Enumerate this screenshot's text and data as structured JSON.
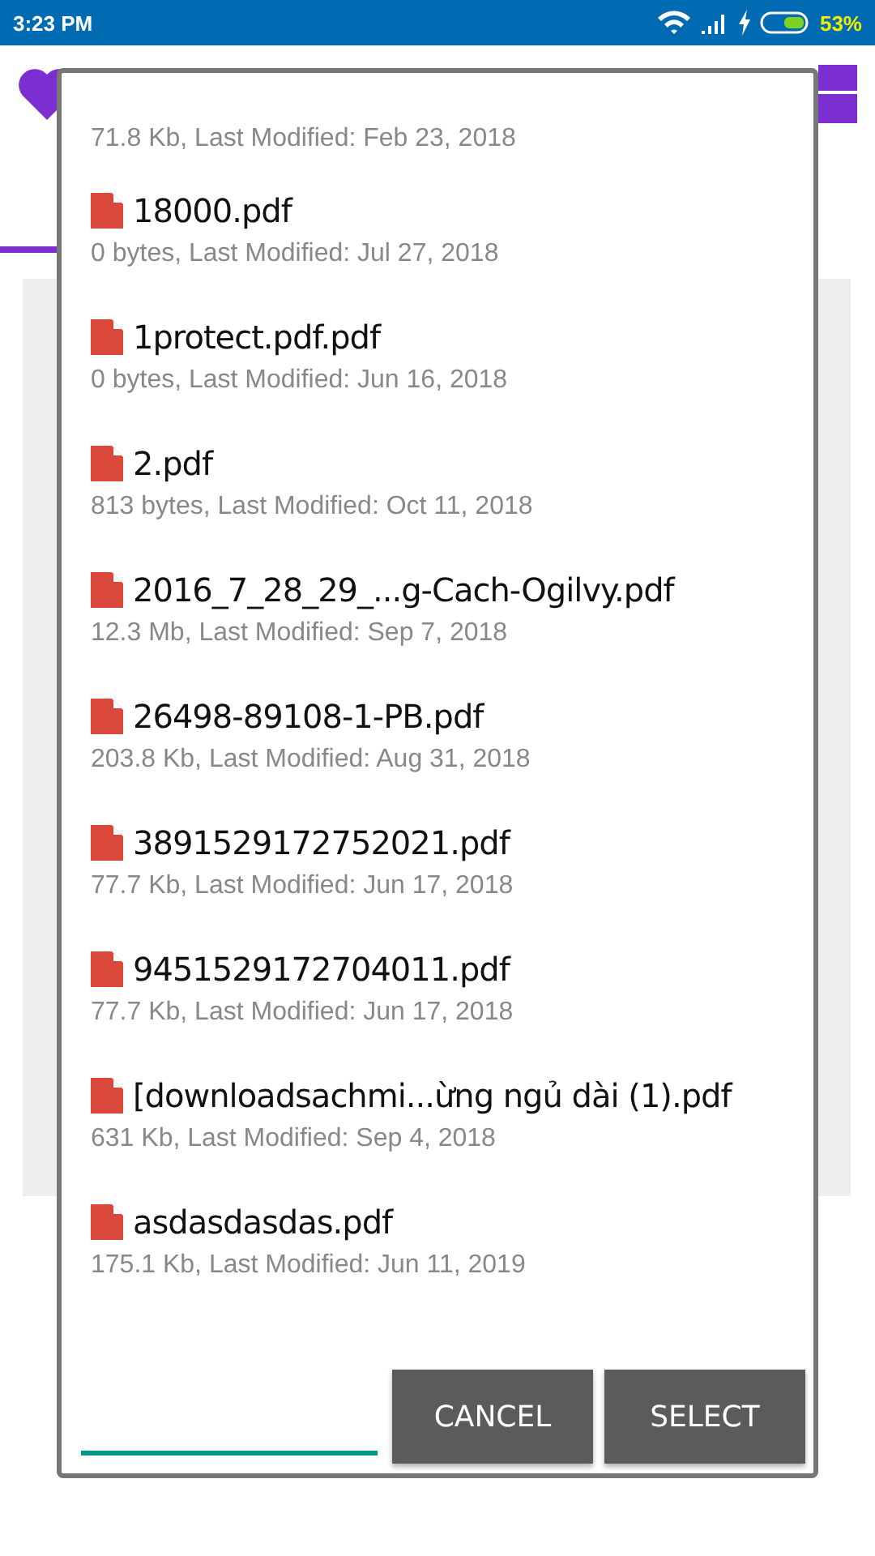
{
  "status_bar": {
    "time": "3:23 PM",
    "battery": "53%"
  },
  "dialog": {
    "files": [
      {
        "meta": "71.8 Kb, Last Modified: Feb 23, 2018"
      },
      {
        "name": "18000.pdf",
        "meta": "0 bytes, Last Modified: Jul 27, 2018"
      },
      {
        "name": "1protect.pdf.pdf",
        "meta": "0 bytes, Last Modified: Jun 16, 2018"
      },
      {
        "name": "2.pdf",
        "meta": "813 bytes, Last Modified: Oct 11, 2018"
      },
      {
        "name": "2016_7_28_29_...g-Cach-Ogilvy.pdf",
        "meta": "12.3 Mb, Last Modified: Sep 7, 2018"
      },
      {
        "name": "26498-89108-1-PB.pdf",
        "meta": "203.8 Kb, Last Modified: Aug 31, 2018"
      },
      {
        "name": "3891529172752021.pdf",
        "meta": "77.7 Kb, Last Modified: Jun 17, 2018"
      },
      {
        "name": "9451529172704011.pdf",
        "meta": "77.7 Kb, Last Modified: Jun 17, 2018"
      },
      {
        "name": "[downloadsachmi...ừng ngủ dài (1).pdf",
        "meta": "631 Kb, Last Modified: Sep 4, 2018"
      },
      {
        "name": "asdasdasdas.pdf",
        "meta": "175.1 Kb, Last Modified: Jun 11, 2019"
      }
    ],
    "buttons": [
      "CANCEL",
      "SELECT"
    ]
  }
}
